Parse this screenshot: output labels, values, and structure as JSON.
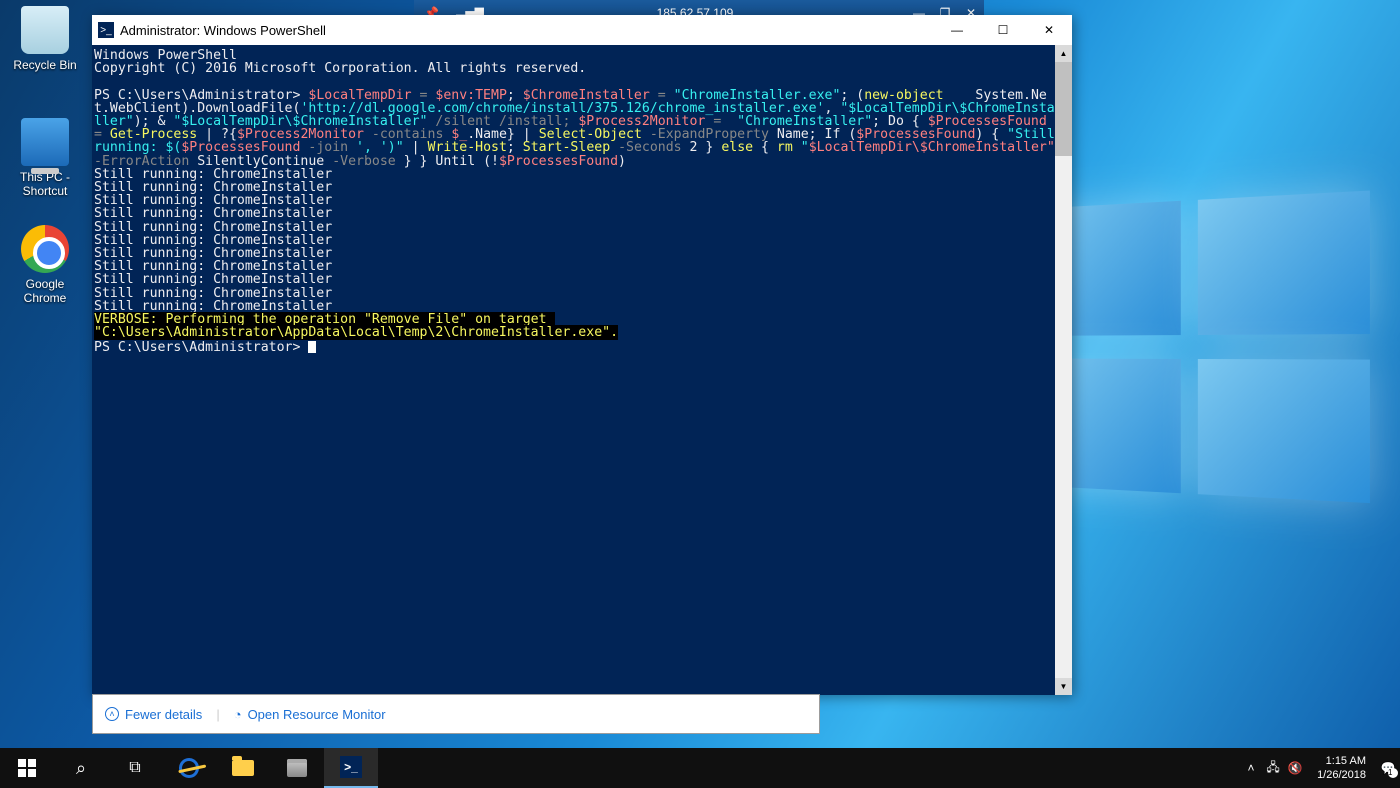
{
  "remote": {
    "ip": "185.62.57.109"
  },
  "desktop": {
    "recycle": "Recycle Bin",
    "thispc": "This PC - Shortcut",
    "chrome": "Google Chrome"
  },
  "ps": {
    "title": "Administrator: Windows PowerShell",
    "header1": "Windows PowerShell",
    "header2": "Copyright (C) 2016 Microsoft Corporation. All rights reserved.",
    "prompt": "PS C:\\Users\\Administrator> ",
    "cmd": {
      "p1a": "$LocalTempDir",
      "p1b": " = ",
      "p1c": "$env:TEMP",
      "p1d": "; ",
      "p1e": "$ChromeInstaller",
      "p1f": " = ",
      "p1g": "\"ChromeInstaller.exe\"",
      "p1h": "; (",
      "p1i": "new-object",
      "p1j": "    System.Net.WebClient).DownloadFile(",
      "p1k": "'http://dl.google.com/chrome/install/375.126/chrome_installer.exe'",
      "p1l": ", ",
      "p1m": "\"$LocalTempDir\\$ChromeInstaller\"",
      "p1n": "); & ",
      "p1o": "\"$LocalTempDir\\$ChromeInstaller\"",
      "p1p": " /silent /install; ",
      "p1q": "$Process2Monitor",
      "p1r": " =  ",
      "p1s": "\"ChromeInstaller\"",
      "p1t": "; Do { ",
      "p1u": "$ProcessesFound",
      "p1v": " = ",
      "p1w": "Get-Process",
      "p1x": " | ?{",
      "p1y": "$Process2Monitor",
      "p1z": " -contains ",
      "p2a": "$_",
      "p2b": ".Name} | ",
      "p2c": "Select-Object",
      "p2d": " -ExpandProperty ",
      "p2e": "Name; If (",
      "p2f": "$ProcessesFound",
      "p2g": ") { ",
      "p2h": "\"Still running: $(",
      "p2h2": "$ProcessesFound",
      "p2i": " -join ",
      "p2j": "', '",
      "p2k": ")\"",
      "p2l": " | ",
      "p2m": "Write-Host",
      "p2n": "; ",
      "p2o": "Start-Sleep",
      "p2p": " -Seconds ",
      "p2q": "2 } ",
      "p2r": "else",
      "p2s": " { ",
      "p2t": "rm",
      "p2u": " \"",
      "p2v": "$LocalTempDir\\$ChromeInstaller\"",
      "p2w": " -ErrorAction ",
      "p2x": "SilentlyContinue",
      "p2y": " -Verbose ",
      "p2z": "} } Until (!",
      "p3a": "$ProcessesFound",
      "p3b": ")"
    },
    "still": "Still running: ChromeInstaller",
    "verbose1": "VERBOSE: Performing the operation \"Remove File\" on target ",
    "verbose2": "\"C:\\Users\\Administrator\\AppData\\Local\\Temp\\2\\ChromeInstaller.exe\"."
  },
  "taskmgr": {
    "fewer": "Fewer details",
    "orm": "Open Resource Monitor"
  },
  "tray": {
    "time": "1:15 AM",
    "date": "1/26/2018"
  }
}
